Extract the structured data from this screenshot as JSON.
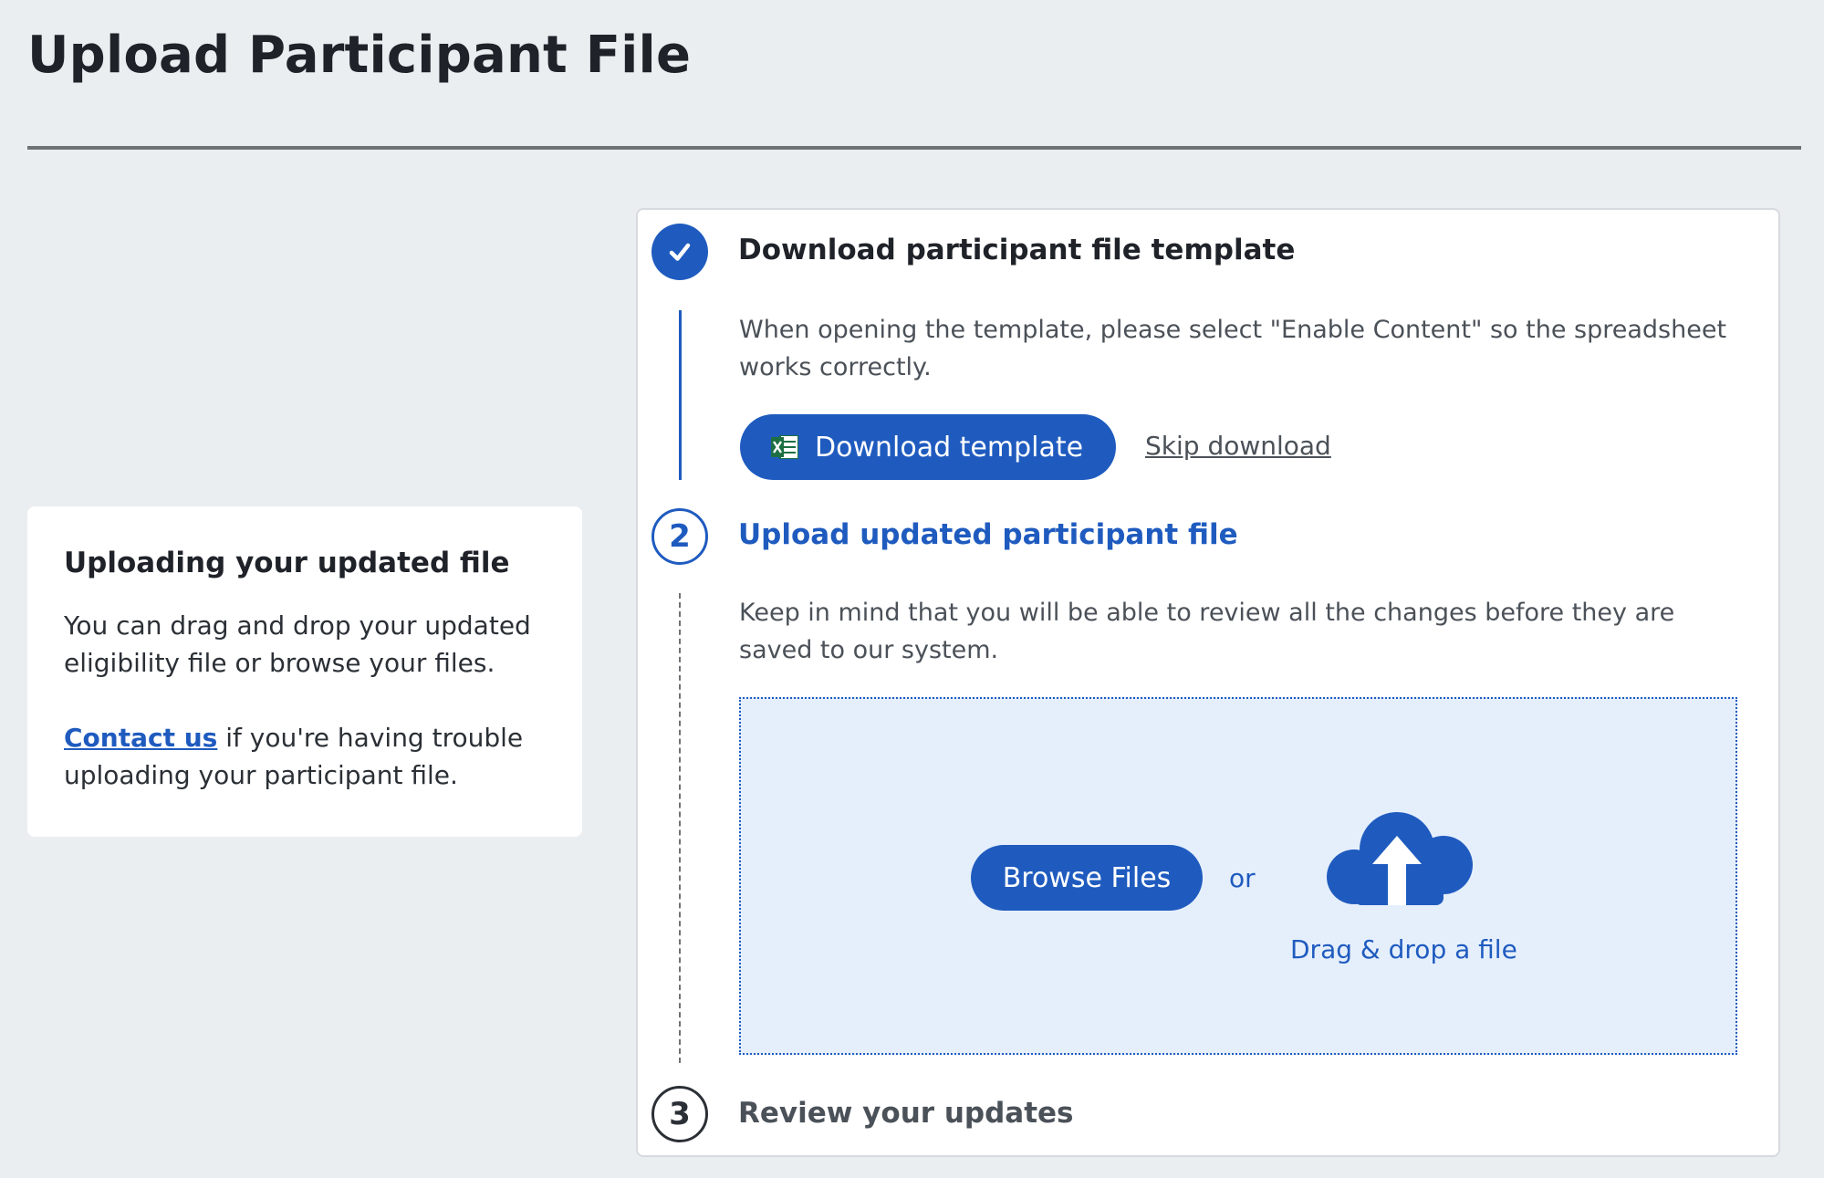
{
  "page": {
    "title": "Upload Participant File"
  },
  "help": {
    "title": "Uploading your updated file",
    "text": "You can drag and drop your updated eligibility file or browse your files.",
    "contact_link": "Contact us",
    "contact_rest": " if you're having trouble uploading your participant file."
  },
  "steps": [
    {
      "number": "",
      "status": "complete",
      "title": "Download participant file template",
      "description": "When opening the template, please select \"Enable Content\" so the spreadsheet works correctly.",
      "primary_button": "Download template",
      "secondary_link": "Skip download"
    },
    {
      "number": "2",
      "status": "active",
      "title": "Upload updated participant file",
      "description": "Keep in mind that you will be able to review all the changes before they are saved to our system.",
      "browse_button": "Browse Files",
      "or_text": "or",
      "drag_text": "Drag & drop a file"
    },
    {
      "number": "3",
      "status": "pending",
      "title": "Review your updates"
    }
  ],
  "icons": {
    "step1": "check-icon",
    "download_button": "excel-icon",
    "dropzone": "cloud-upload-icon"
  },
  "colors": {
    "accent": "#1f5bbf",
    "background": "#ebeef1",
    "dropzone_bg": "#e5effc"
  }
}
